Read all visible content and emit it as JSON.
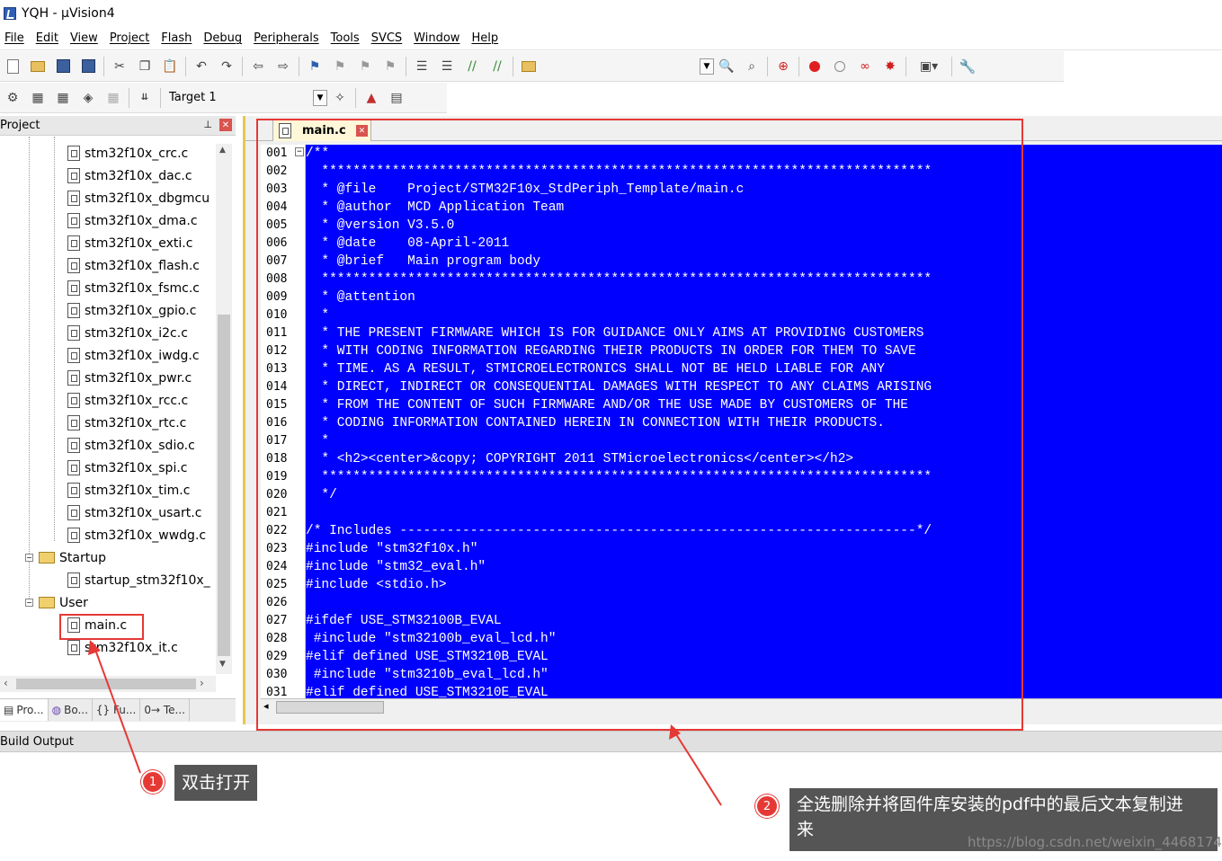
{
  "window": {
    "title": "YQH  - µVision4"
  },
  "menu": [
    "File",
    "Edit",
    "View",
    "Project",
    "Flash",
    "Debug",
    "Peripherals",
    "Tools",
    "SVCS",
    "Window",
    "Help"
  ],
  "toolbar": {
    "target": "Target 1"
  },
  "project_pane": {
    "title": "Project",
    "files": [
      "stm32f10x_crc.c",
      "stm32f10x_dac.c",
      "stm32f10x_dbgmcu",
      "stm32f10x_dma.c",
      "stm32f10x_exti.c",
      "stm32f10x_flash.c",
      "stm32f10x_fsmc.c",
      "stm32f10x_gpio.c",
      "stm32f10x_i2c.c",
      "stm32f10x_iwdg.c",
      "stm32f10x_pwr.c",
      "stm32f10x_rcc.c",
      "stm32f10x_rtc.c",
      "stm32f10x_sdio.c",
      "stm32f10x_spi.c",
      "stm32f10x_tim.c",
      "stm32f10x_usart.c",
      "stm32f10x_wwdg.c"
    ],
    "startup_group": "Startup",
    "startup_file": "startup_stm32f10x_",
    "user_group": "User",
    "user_files": [
      "main.c",
      "stm32f10x_it.c"
    ],
    "tabs": [
      "Pro...",
      "Bo...",
      "{} Fu...",
      "0→ Te..."
    ]
  },
  "build_output": "Build Output",
  "editor": {
    "tab": "main.c",
    "lines": [
      {
        "n": "001",
        "t": "/**"
      },
      {
        "n": "002",
        "t": "  ******************************************************************************"
      },
      {
        "n": "003",
        "t": "  * @file    Project/STM32F10x_StdPeriph_Template/main.c"
      },
      {
        "n": "004",
        "t": "  * @author  MCD Application Team"
      },
      {
        "n": "005",
        "t": "  * @version V3.5.0"
      },
      {
        "n": "006",
        "t": "  * @date    08-April-2011"
      },
      {
        "n": "007",
        "t": "  * @brief   Main program body"
      },
      {
        "n": "008",
        "t": "  ******************************************************************************"
      },
      {
        "n": "009",
        "t": "  * @attention"
      },
      {
        "n": "010",
        "t": "  *"
      },
      {
        "n": "011",
        "t": "  * THE PRESENT FIRMWARE WHICH IS FOR GUIDANCE ONLY AIMS AT PROVIDING CUSTOMERS"
      },
      {
        "n": "012",
        "t": "  * WITH CODING INFORMATION REGARDING THEIR PRODUCTS IN ORDER FOR THEM TO SAVE"
      },
      {
        "n": "013",
        "t": "  * TIME. AS A RESULT, STMICROELECTRONICS SHALL NOT BE HELD LIABLE FOR ANY"
      },
      {
        "n": "014",
        "t": "  * DIRECT, INDIRECT OR CONSEQUENTIAL DAMAGES WITH RESPECT TO ANY CLAIMS ARISING"
      },
      {
        "n": "015",
        "t": "  * FROM THE CONTENT OF SUCH FIRMWARE AND/OR THE USE MADE BY CUSTOMERS OF THE"
      },
      {
        "n": "016",
        "t": "  * CODING INFORMATION CONTAINED HEREIN IN CONNECTION WITH THEIR PRODUCTS."
      },
      {
        "n": "017",
        "t": "  *"
      },
      {
        "n": "018",
        "t": "  * <h2><center>&copy; COPYRIGHT 2011 STMicroelectronics</center></h2>"
      },
      {
        "n": "019",
        "t": "  ******************************************************************************"
      },
      {
        "n": "020",
        "t": "  */"
      },
      {
        "n": "021",
        "t": ""
      },
      {
        "n": "022",
        "t": "/* Includes ------------------------------------------------------------------*/"
      },
      {
        "n": "023",
        "t": "#include \"stm32f10x.h\""
      },
      {
        "n": "024",
        "t": "#include \"stm32_eval.h\""
      },
      {
        "n": "025",
        "t": "#include <stdio.h>"
      },
      {
        "n": "026",
        "t": ""
      },
      {
        "n": "027",
        "t": "#ifdef USE_STM32100B_EVAL"
      },
      {
        "n": "028",
        "t": " #include \"stm32100b_eval_lcd.h\""
      },
      {
        "n": "029",
        "t": "#elif defined USE_STM3210B_EVAL"
      },
      {
        "n": "030",
        "t": " #include \"stm3210b_eval_lcd.h\""
      },
      {
        "n": "031",
        "t": "#elif defined USE_STM3210E_EVAL"
      }
    ]
  },
  "annotations": {
    "step1": {
      "num": "1",
      "text": "双击打开"
    },
    "step2": {
      "num": "2",
      "text_line1": "全选删除并将固件库安装的pdf中的最后文本复制进",
      "text_line2": "来"
    },
    "color": "#e53935"
  },
  "watermark": "https://blog.csdn.net/weixin_44681745"
}
